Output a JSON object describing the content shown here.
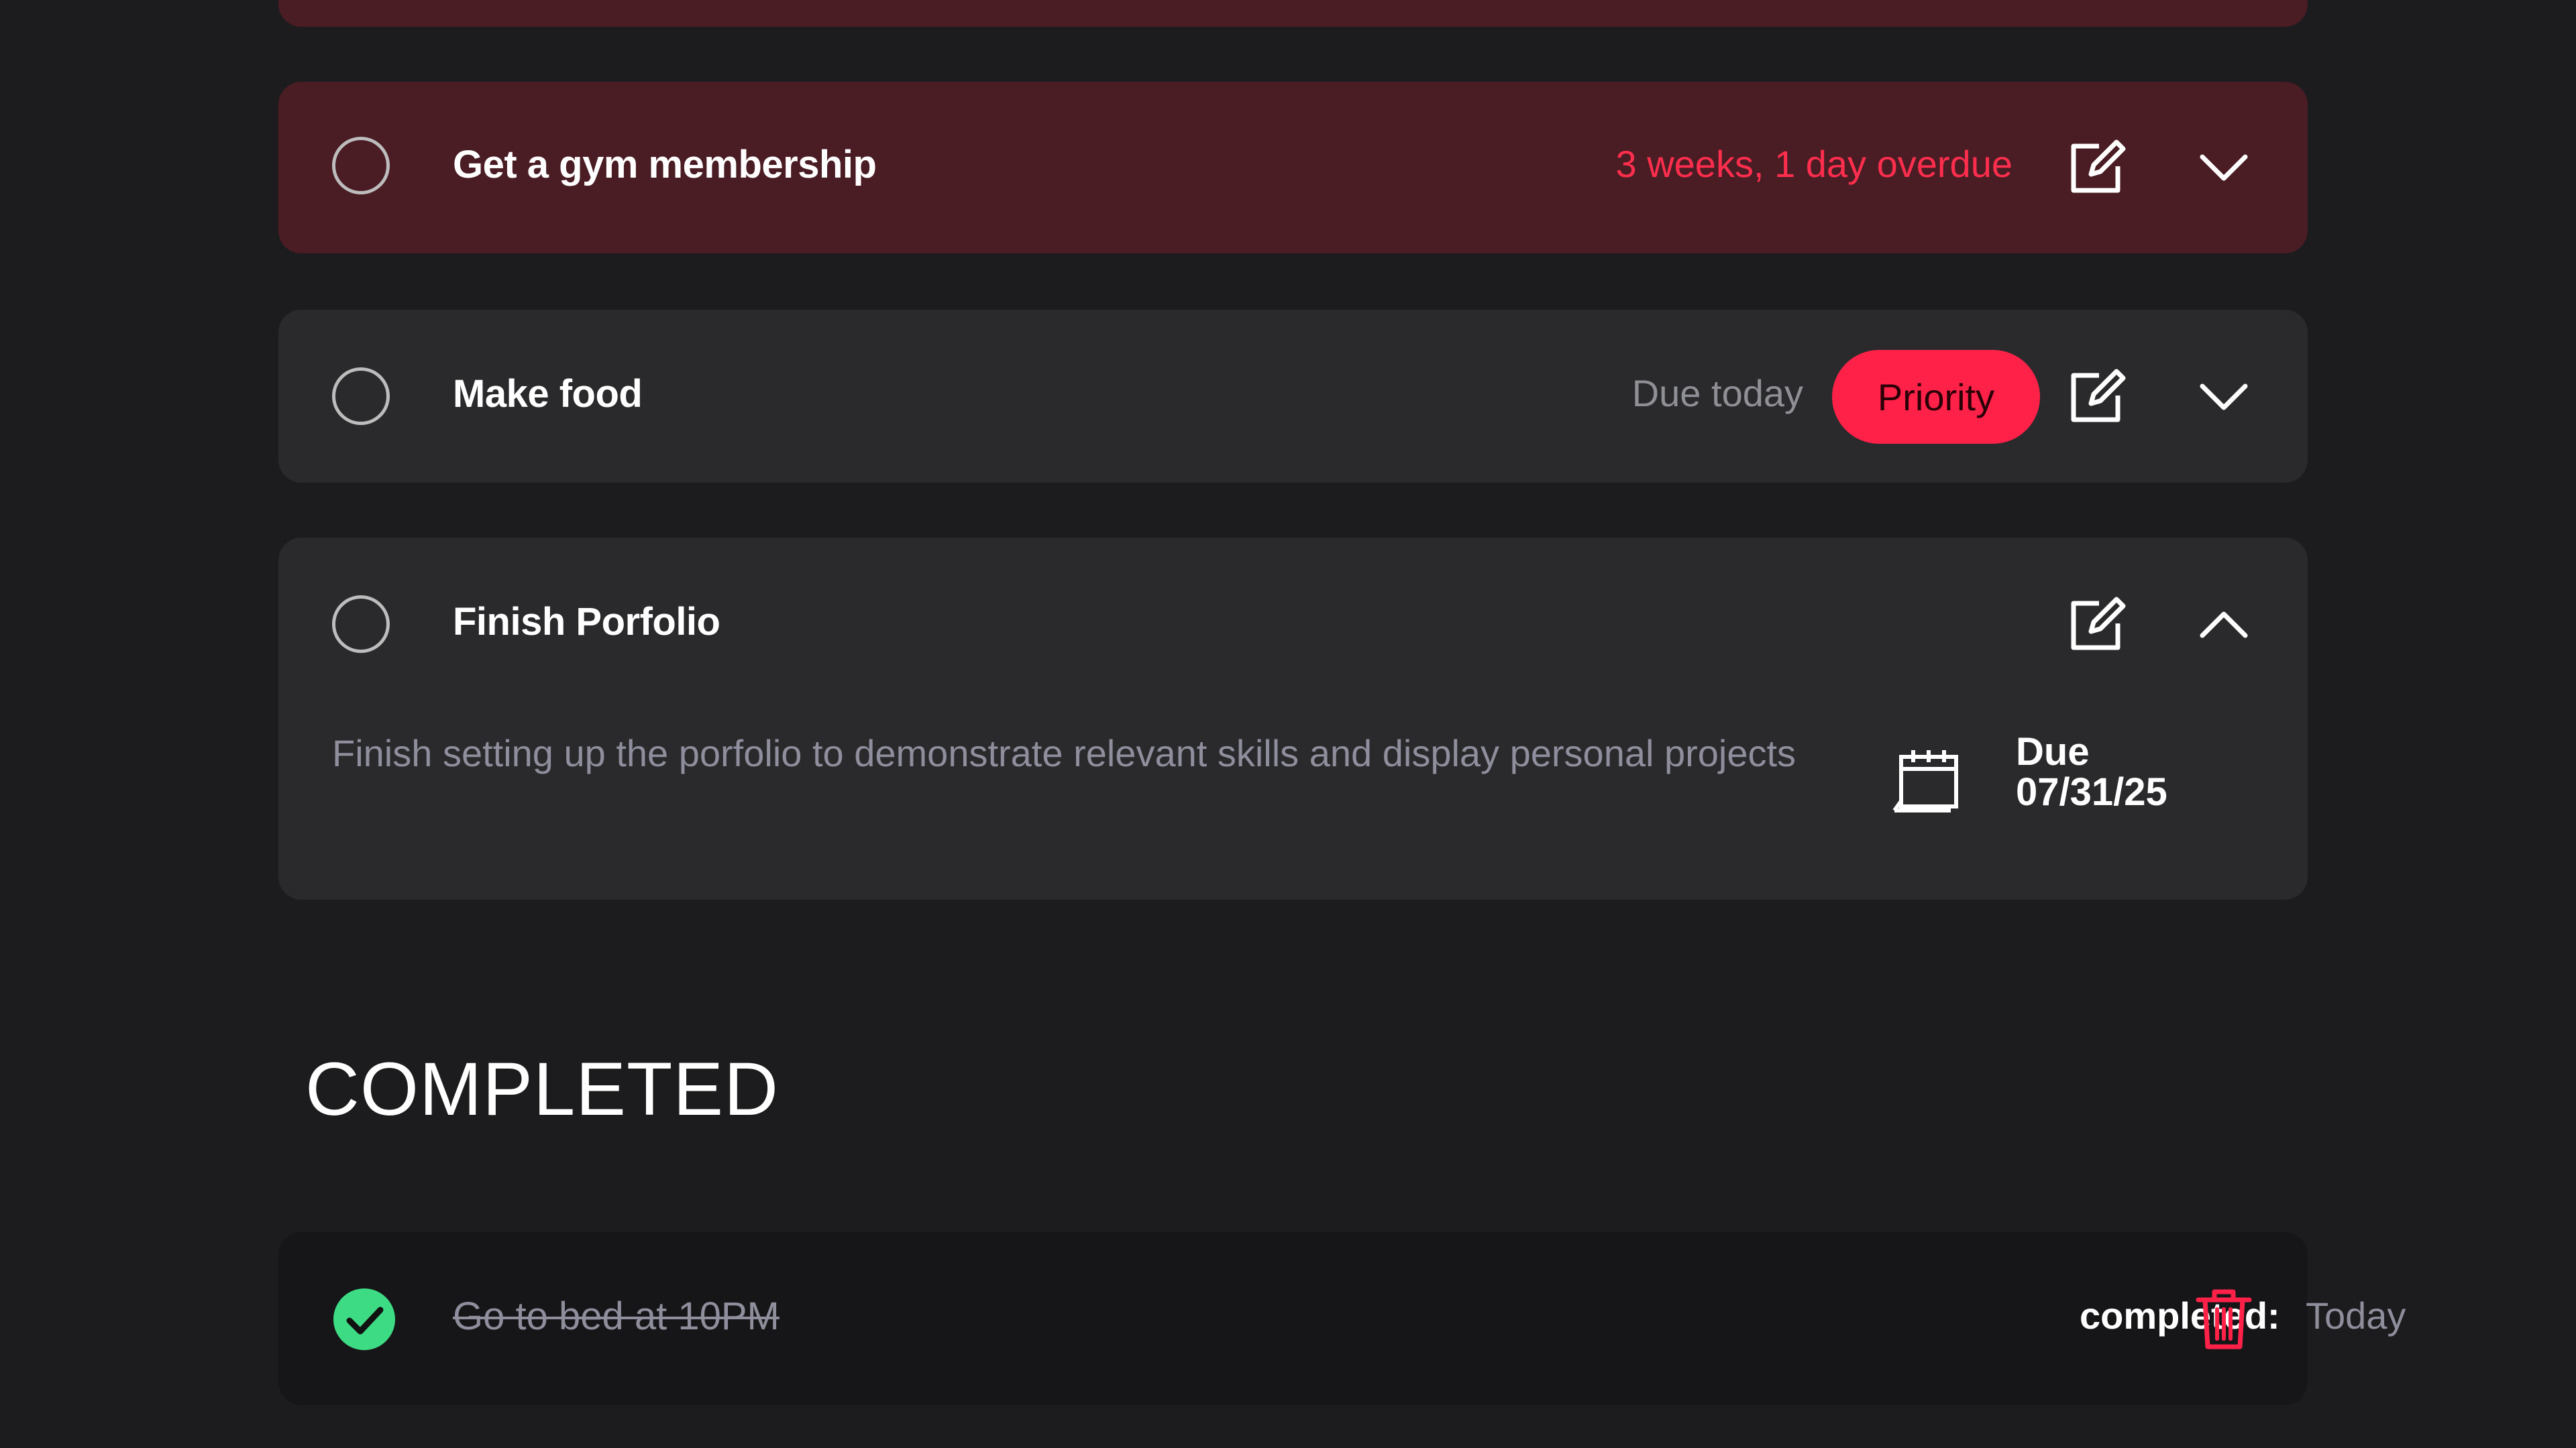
{
  "tasks": [
    {
      "title": "Get a gym membership",
      "status_text": "3 weeks, 1 day overdue",
      "state": "overdue"
    },
    {
      "title": "Make food",
      "status_text": "Due today",
      "badge": "Priority",
      "state": "normal"
    },
    {
      "title": "Finish Porfolio",
      "description": "Finish setting up the porfolio to demonstrate relevant skills and display personal projects",
      "due_label": "Due",
      "due_date": "07/31/25",
      "state": "expanded"
    }
  ],
  "completed_section": {
    "heading": "COMPLETED",
    "items": [
      {
        "title": "Go to bed at 10PM",
        "completed_label": "completed:",
        "completed_value": "Today"
      }
    ]
  },
  "colors": {
    "background": "#1c1c1e",
    "overdue_card": "#4a1c24",
    "card": "#2a2a2d",
    "accent_red": "#ff2148",
    "check_green": "#3ddc84"
  },
  "icons": {
    "edit": "edit-icon",
    "expand": "chevron-down-icon",
    "collapse": "chevron-up-icon",
    "calendar": "calendar-icon",
    "delete": "trash-icon",
    "check": "check-circle-icon"
  }
}
